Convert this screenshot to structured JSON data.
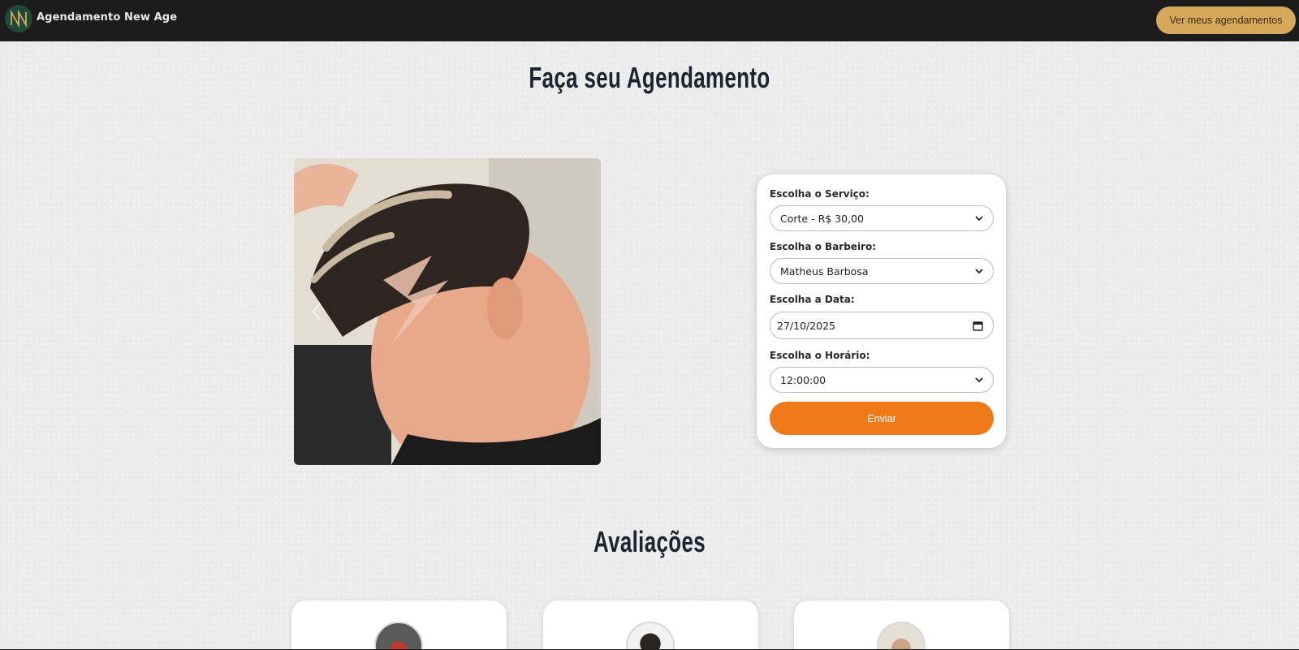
{
  "header": {
    "brand": "Agendamento New Age",
    "appointments_button": "Ver meus agendamentos"
  },
  "booking": {
    "title": "Faça seu Agendamento",
    "service_label": "Escolha o Serviço:",
    "service_value": "Corte - R$ 30,00",
    "barber_label": "Escolha o Barbeiro:",
    "barber_value": "Matheus Barbosa",
    "date_label": "Escolha a Data:",
    "date_value": "27/10/2025",
    "time_label": "Escolha o Horário:",
    "time_value": "12:00:00",
    "submit": "Enviar"
  },
  "reviews": {
    "title": "Avaliações"
  },
  "colors": {
    "header_bg": "#1c1c1c",
    "accent_button": "#d6a85a",
    "submit_button": "#ef7a1a",
    "logo_bg": "#1f4a3a"
  },
  "icons": {
    "logo": "nn-monogram-logo",
    "carousel_prev": "chevron-left-icon",
    "select_arrow": "chevron-down-icon",
    "date_picker": "calendar-icon"
  }
}
